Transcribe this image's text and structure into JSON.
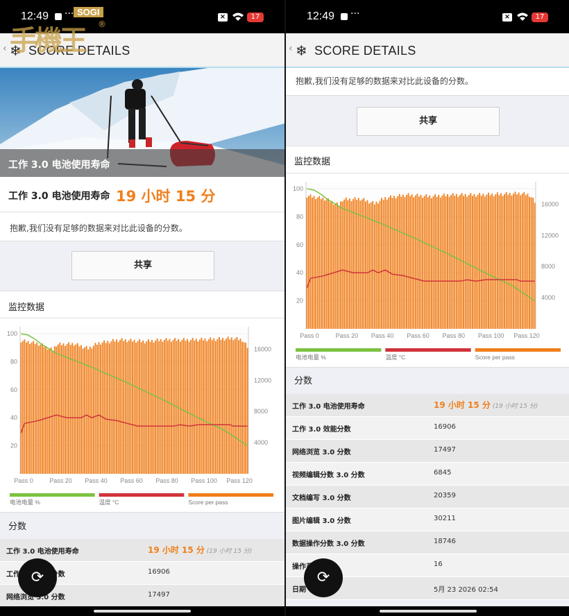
{
  "status": {
    "time": "12:49",
    "dots": "···",
    "battery": "17"
  },
  "watermark": {
    "brand": "SOGI",
    "registered": "®",
    "han": "手機王"
  },
  "appbar": {
    "back": "‹",
    "title": "SCORE DETAILS"
  },
  "hero": {
    "caption": "工作 3.0 电池使用寿命"
  },
  "result": {
    "label": "工作 3.0 电池使用寿命",
    "value": "19 小时 15 分"
  },
  "notice": "抱歉,我们没有足够的数据来对比此设备的分数。",
  "share_label": "共享",
  "monitor_title": "监控数据",
  "chart_data": {
    "type": "bar",
    "x_tick_labels": [
      "Pass 0",
      "Pass 20",
      "Pass 40",
      "Pass 60",
      "Pass 80",
      "Pass 100",
      "Pass 120"
    ],
    "left_axis_ticks": [
      "100",
      "80",
      "60",
      "40",
      "20"
    ],
    "right_axis_ticks": [
      "16000",
      "12000",
      "8000",
      "4000"
    ],
    "ylim_left": [
      0,
      100
    ],
    "ylim_right": [
      0,
      18000
    ],
    "passes": 129,
    "legend": [
      {
        "name": "电池电量 %",
        "color": "#7cc242"
      },
      {
        "name": "温度 °C",
        "color": "#d0343a"
      },
      {
        "name": "Score per pass",
        "color": "#f07f1c"
      }
    ],
    "series": [
      {
        "name": "Score per pass",
        "axis": "right",
        "type": "bar",
        "color": "#f07f1c",
        "points": [
          [
            0,
            17100
          ],
          [
            10,
            16700
          ],
          [
            18,
            15900
          ],
          [
            20,
            16600
          ],
          [
            30,
            16700
          ],
          [
            38,
            16100
          ],
          [
            44,
            16800
          ],
          [
            56,
            17200
          ],
          [
            70,
            17000
          ],
          [
            80,
            17200
          ],
          [
            95,
            17200
          ],
          [
            110,
            17300
          ],
          [
            120,
            17400
          ],
          [
            125,
            17200
          ],
          [
            128,
            16300
          ]
        ]
      },
      {
        "name": "电池电量 %",
        "axis": "left",
        "type": "line",
        "color": "#7cc242",
        "points": [
          [
            0,
            100
          ],
          [
            4,
            99
          ],
          [
            8,
            96
          ],
          [
            12,
            92
          ],
          [
            20,
            86
          ],
          [
            40,
            76
          ],
          [
            60,
            65
          ],
          [
            80,
            53
          ],
          [
            100,
            40
          ],
          [
            115,
            31
          ],
          [
            128,
            20
          ]
        ]
      },
      {
        "name": "温度 °C",
        "axis": "left",
        "type": "line",
        "color": "#d0343a",
        "points": [
          [
            0,
            29
          ],
          [
            2,
            36
          ],
          [
            10,
            38
          ],
          [
            20,
            42
          ],
          [
            26,
            40
          ],
          [
            34,
            40
          ],
          [
            37,
            42
          ],
          [
            40,
            40
          ],
          [
            44,
            42
          ],
          [
            48,
            39
          ],
          [
            54,
            38
          ],
          [
            60,
            36
          ],
          [
            66,
            34
          ],
          [
            86,
            34
          ],
          [
            90,
            35
          ],
          [
            95,
            34
          ],
          [
            100,
            35
          ],
          [
            118,
            35
          ],
          [
            120,
            34
          ],
          [
            128,
            34
          ]
        ]
      }
    ]
  },
  "scores_title": "分数",
  "scores": [
    {
      "label": "工作 3.0 电池使用寿命",
      "value": "19 小时 15 分",
      "sub": "(19 小时 15 分)"
    },
    {
      "label": "工作 3.0 效能分数",
      "value": "16906"
    },
    {
      "label": "网络浏览 3.0 分数",
      "value": "17497"
    },
    {
      "label": "视频编辑分数 3.0 分数",
      "value": "6845"
    },
    {
      "label": "文档编写 3.0 分数",
      "value": "20359"
    },
    {
      "label": "图片编辑 3.0 分数",
      "value": "30211"
    },
    {
      "label": "数据操作分数 3.0 分数",
      "value": "18746"
    },
    {
      "label": "操作系统版本",
      "value": "16"
    },
    {
      "label": "日期",
      "value": "5月 23 2026 02:54"
    }
  ]
}
